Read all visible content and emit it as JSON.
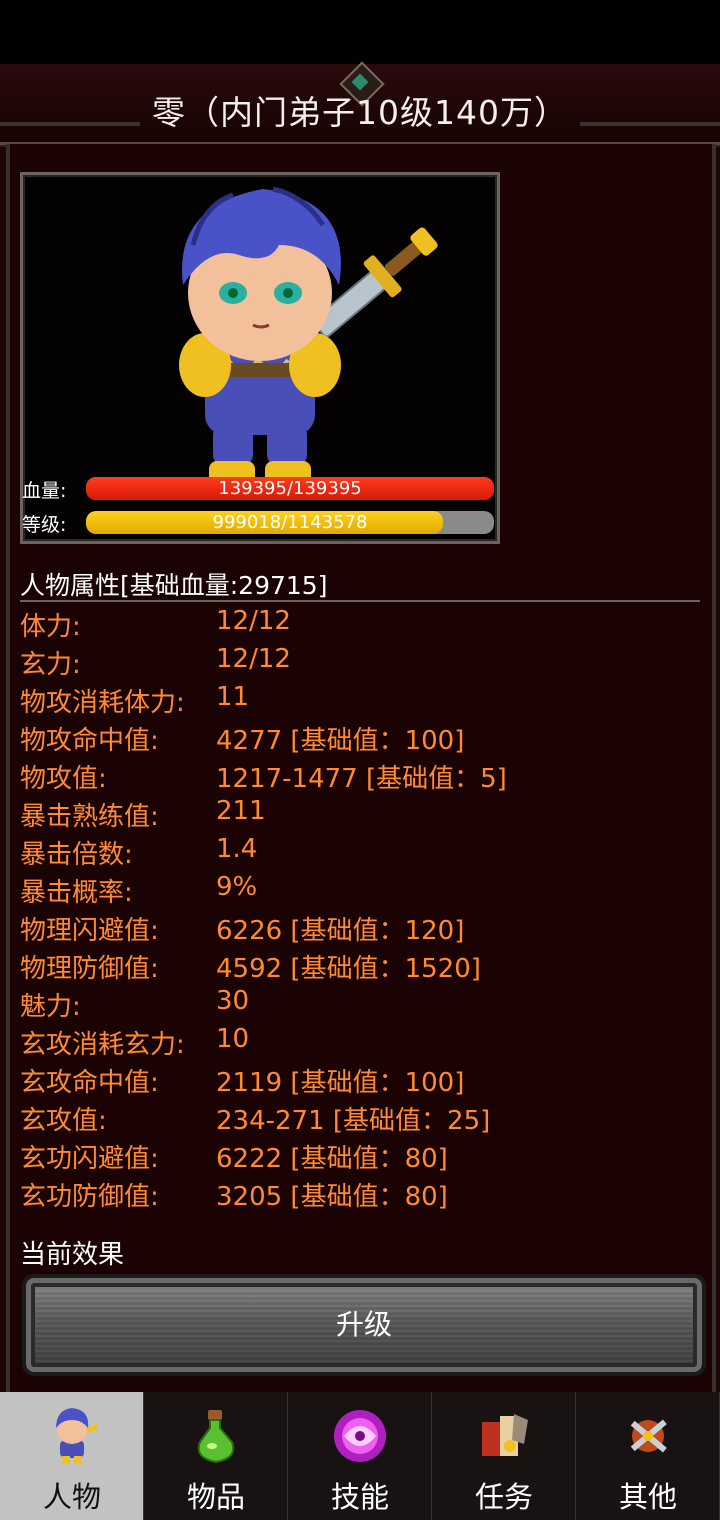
{
  "window": {
    "title": "零（内门弟子10级140万）"
  },
  "character": {
    "hp_label": "血量:",
    "hp_text": "139395/139395",
    "hp_fraction": 1.0,
    "level_label": "等级:",
    "level_text": "999018/1143578",
    "level_fraction": 0.874
  },
  "attributes": {
    "header": "人物属性[基础血量:29715]",
    "rows": [
      {
        "label": "体力:",
        "value": "12/12"
      },
      {
        "label": "玄力:",
        "value": "12/12"
      },
      {
        "label": "物攻消耗体力:",
        "value": "11"
      },
      {
        "label": "物攻命中值:",
        "value": "4277 [基础值：100]"
      },
      {
        "label": "物攻值:",
        "value": "1217-1477 [基础值：5]"
      },
      {
        "label": "暴击熟练值:",
        "value": "211"
      },
      {
        "label": "暴击倍数:",
        "value": "1.4"
      },
      {
        "label": "暴击概率:",
        "value": "9%"
      },
      {
        "label": "物理闪避值:",
        "value": "6226 [基础值：120]"
      },
      {
        "label": "物理防御值:",
        "value": "4592 [基础值：1520]"
      },
      {
        "label": "魅力:",
        "value": "30"
      },
      {
        "label": "玄攻消耗玄力:",
        "value": "10"
      },
      {
        "label": "玄攻命中值:",
        "value": "2119 [基础值：100]"
      },
      {
        "label": "玄攻值:",
        "value": "234-271 [基础值：25]"
      },
      {
        "label": "玄功闪避值:",
        "value": "6222 [基础值：80]"
      },
      {
        "label": "玄功防御值:",
        "value": "3205 [基础值：80]"
      }
    ]
  },
  "effects": {
    "label": "当前效果"
  },
  "upgrade_button": {
    "label": "升级"
  },
  "tabs": [
    {
      "label": "人物",
      "icon": "character-icon",
      "active": true
    },
    {
      "label": "物品",
      "icon": "potion-icon",
      "active": false
    },
    {
      "label": "技能",
      "icon": "skill-orb-icon",
      "active": false
    },
    {
      "label": "任务",
      "icon": "quest-icon",
      "active": false
    },
    {
      "label": "其他",
      "icon": "crossed-swords-icon",
      "active": false
    }
  ],
  "colors": {
    "hp_bar": "#e8200c",
    "level_bar": "#f0c010",
    "stat_text": "#ff8a32",
    "panel_bg": "#1b0303"
  }
}
